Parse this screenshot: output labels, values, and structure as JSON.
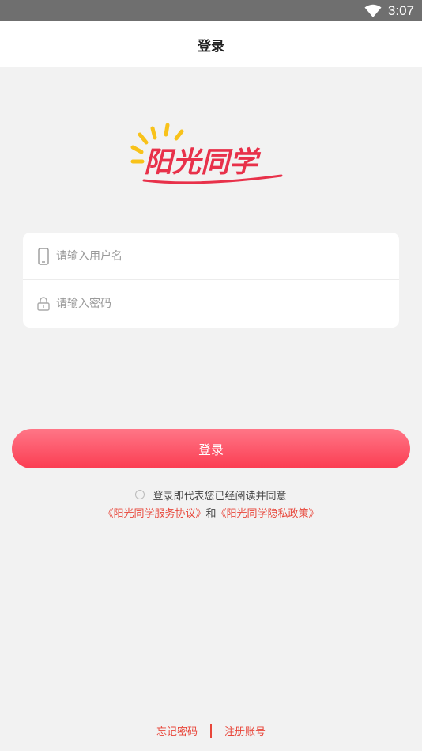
{
  "status_bar": {
    "time": "3:07",
    "icon": "wifi-icon"
  },
  "header": {
    "title": "登录"
  },
  "logo": {
    "text": "阳光同学",
    "colors": {
      "sun": "#f8c21a",
      "text": "#e8314a"
    }
  },
  "form": {
    "username": {
      "placeholder": "请输入用户名",
      "value": "",
      "icon": "phone-icon"
    },
    "password": {
      "placeholder": "请输入密码",
      "value": "",
      "icon": "lock-icon"
    }
  },
  "login_button": {
    "label": "登录",
    "color_top": "#ff7687",
    "color_bottom": "#fb3d52"
  },
  "agreement": {
    "text": "登录即代表您已经阅读并同意",
    "checked": false,
    "service_link": "《阳光同学服务协议》",
    "conjunction": "和",
    "privacy_link": "《阳光同学隐私政策》"
  },
  "footer": {
    "forgot_password": "忘记密码",
    "register": "注册账号"
  }
}
